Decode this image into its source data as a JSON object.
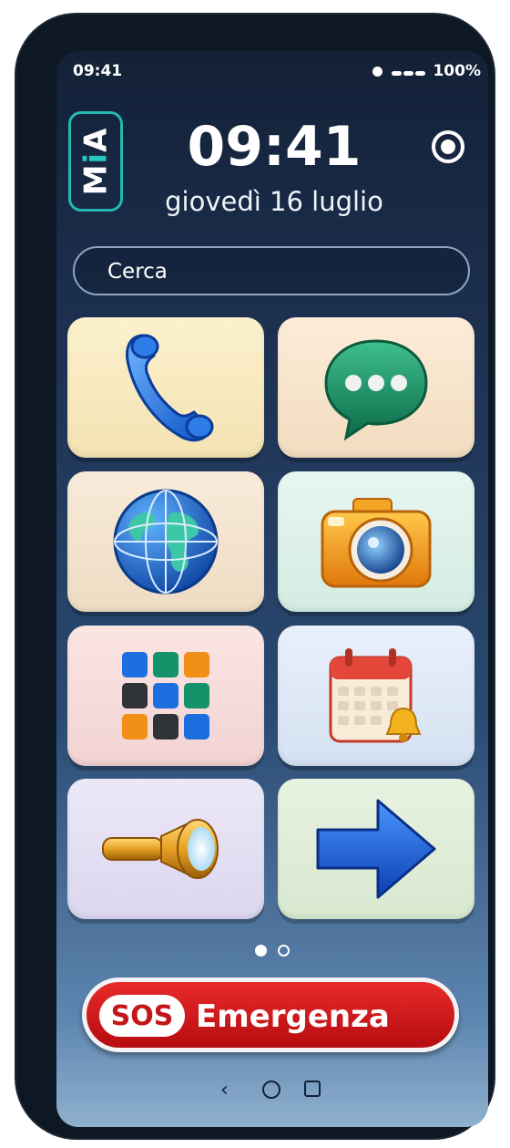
{
  "status_bar": {
    "time": "09:41",
    "battery": "100%"
  },
  "logo": {
    "text_first": "M",
    "text_middle": "i",
    "text_last": "A"
  },
  "clock": {
    "time": "09:41",
    "date": "giovedì 16 luglio"
  },
  "search": {
    "placeholder": "Cerca"
  },
  "tiles": [
    {
      "icon": "phone-icon"
    },
    {
      "icon": "message-icon"
    },
    {
      "icon": "globe-icon"
    },
    {
      "icon": "camera-icon"
    },
    {
      "icon": "apps-grid-icon"
    },
    {
      "icon": "calendar-alarm-icon"
    },
    {
      "icon": "flashlight-icon"
    },
    {
      "icon": "arrow-right-icon"
    }
  ],
  "pager": {
    "pages": 2,
    "active": 1
  },
  "emergency": {
    "badge": "SOS",
    "label": "Emergenza"
  },
  "colors": {
    "accent": "#23b8b4",
    "sos_red": "#d41a1f"
  }
}
